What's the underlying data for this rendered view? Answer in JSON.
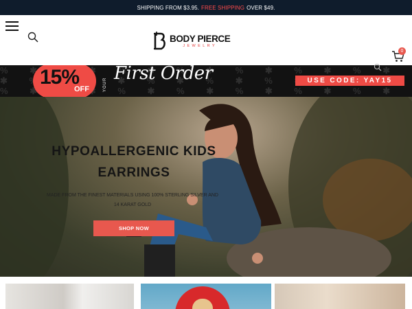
{
  "announcement": {
    "prefix": "SHIPPING FROM $3.95.",
    "highlight": "FREE SHIPPING",
    "suffix": "OVER $49."
  },
  "header": {
    "logo_main": "BODY PIERCE",
    "logo_sub": "JEWELRY",
    "cart_count": "0"
  },
  "promo": {
    "percent": "15%",
    "off": "OFF",
    "your": "YOUR",
    "first_order": "First Order",
    "code": "USE CODE: YAY15"
  },
  "hero": {
    "title": "HYPOALLERGENIC KIDS EARRINGS",
    "subtitle": "MADE FROM THE FINEST MATERIALS USING 100% STERLING SILVER AND 14 KARAT GOLD",
    "button": "SHOP NOW"
  },
  "colors": {
    "accent": "#e8584e",
    "announcement_bg": "#0f1c2c",
    "promo_bg": "#121212"
  },
  "icons": [
    "menu-icon",
    "search-icon",
    "logo-b-icon",
    "cart-icon",
    "search-icon"
  ]
}
